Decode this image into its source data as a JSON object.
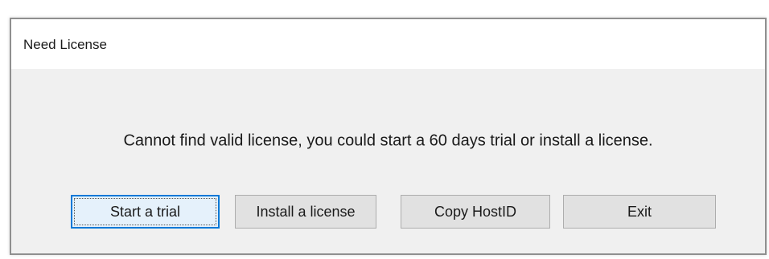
{
  "dialog": {
    "title": "Need License",
    "message": "Cannot find valid license, you could start a 60 days trial or install a license.",
    "buttons": {
      "start_trial": "Start a trial",
      "install_license": "Install a license",
      "copy_hostid": "Copy HostID",
      "exit": "Exit"
    }
  },
  "colors": {
    "dialog_background": "#f0f0f0",
    "titlebar_background": "#ffffff",
    "button_background": "#e1e1e1",
    "default_button_border": "#0078d7"
  }
}
